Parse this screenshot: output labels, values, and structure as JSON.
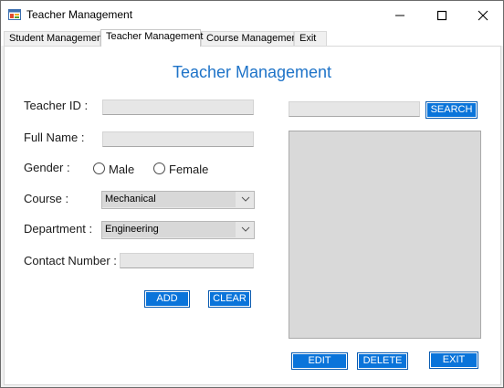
{
  "window": {
    "title": "Teacher Management",
    "icon": "app-form-icon",
    "controls": [
      "minimize-icon",
      "maximize-icon",
      "close-icon"
    ]
  },
  "tabs": [
    {
      "label": "Student Management",
      "active": false
    },
    {
      "label": "Teacher Management",
      "active": true
    },
    {
      "label": "Course Management",
      "active": false
    },
    {
      "label": "Exit",
      "active": false
    }
  ],
  "form": {
    "heading": "Teacher Management",
    "teacher_id_label": "Teacher ID :",
    "teacher_id_value": "",
    "full_name_label": "Full Name :",
    "full_name_value": "",
    "gender_label": "Gender :",
    "gender_options": [
      "Male",
      "Female"
    ],
    "gender_selected": "",
    "course_label": "Course :",
    "course_value": "Mechanical",
    "department_label": "Department :",
    "department_value": "Engineering",
    "contact_label": "Contact Number :",
    "contact_value": "",
    "add_label": "ADD",
    "clear_label": "CLEAR"
  },
  "search": {
    "value": "",
    "button_label": "SEARCH"
  },
  "actions": {
    "edit_label": "EDIT",
    "delete_label": "DELETE",
    "exit_label": "EXIT"
  },
  "colors": {
    "accent": "#0a74da",
    "heading": "#1e73c8"
  }
}
